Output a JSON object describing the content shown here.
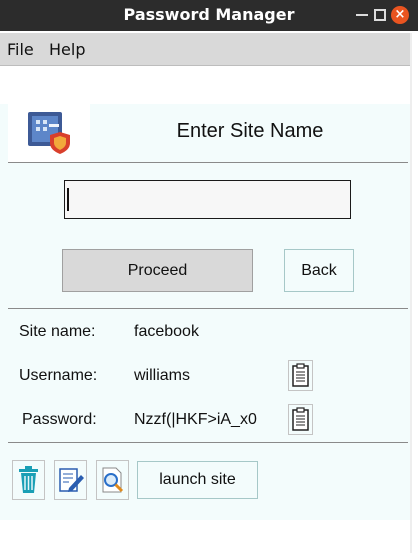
{
  "window": {
    "title": "Password Manager",
    "close_glyph": "×"
  },
  "menu": {
    "items": [
      "File",
      "Help"
    ]
  },
  "header": {
    "icon": "vault-shield-icon",
    "title": "Enter Site Name"
  },
  "site_input": {
    "value": "",
    "placeholder": ""
  },
  "buttons": {
    "proceed": "Proceed",
    "back": "Back",
    "launch": "launch site"
  },
  "details": {
    "site_label": "Site name:",
    "site_value": "facebook",
    "username_label": "Username:",
    "username_value": "williams",
    "password_label": "Password:",
    "password_value": "Nzzf(|HKF>iA_x0"
  },
  "toolbar_icons": [
    "trash-icon",
    "edit-icon",
    "search-icon"
  ],
  "colors": {
    "titlebar": "#2c2c2c",
    "close": "#e95420",
    "panel": "#f3fcfc",
    "trash": "#1a9fb5"
  }
}
